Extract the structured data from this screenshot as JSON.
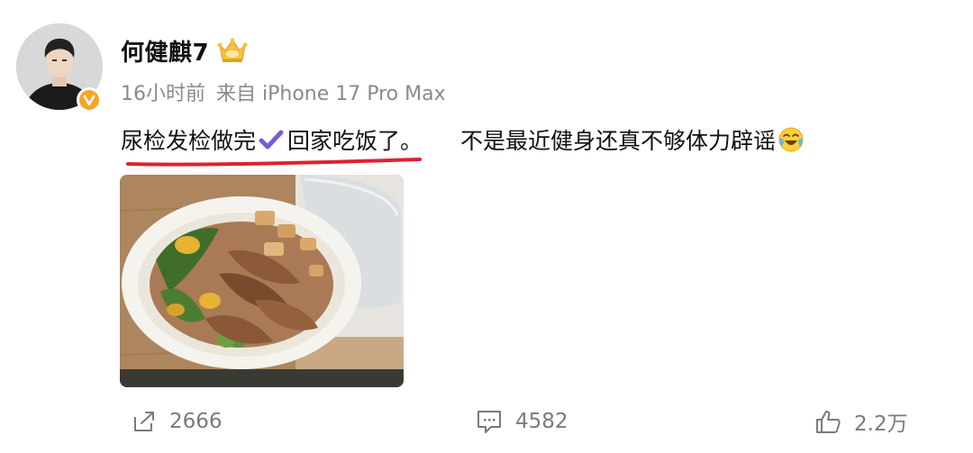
{
  "post": {
    "author": "何健麒7",
    "time": "16小时前",
    "source": "来自 iPhone 17 Pro Max",
    "text_part1": "尿检发检做完",
    "text_part2": "回家吃饭了。",
    "text_part3": "不是最近健身还真不够体力辟谣",
    "icons": {
      "verified": "verified-badge-icon",
      "member": "member-crown-icon",
      "check": "purple-check-icon",
      "emoji": "laugh-cry-emoji-icon"
    },
    "colors": {
      "username": "#111111",
      "meta": "#8a8a8a",
      "underline": "#e0202e",
      "check": "#7b5bd6",
      "verified": "#f5a623",
      "action": "#7a7a7a"
    }
  },
  "actions": {
    "share_count": "2666",
    "comment_count": "4582",
    "like_count": "2.2万"
  }
}
